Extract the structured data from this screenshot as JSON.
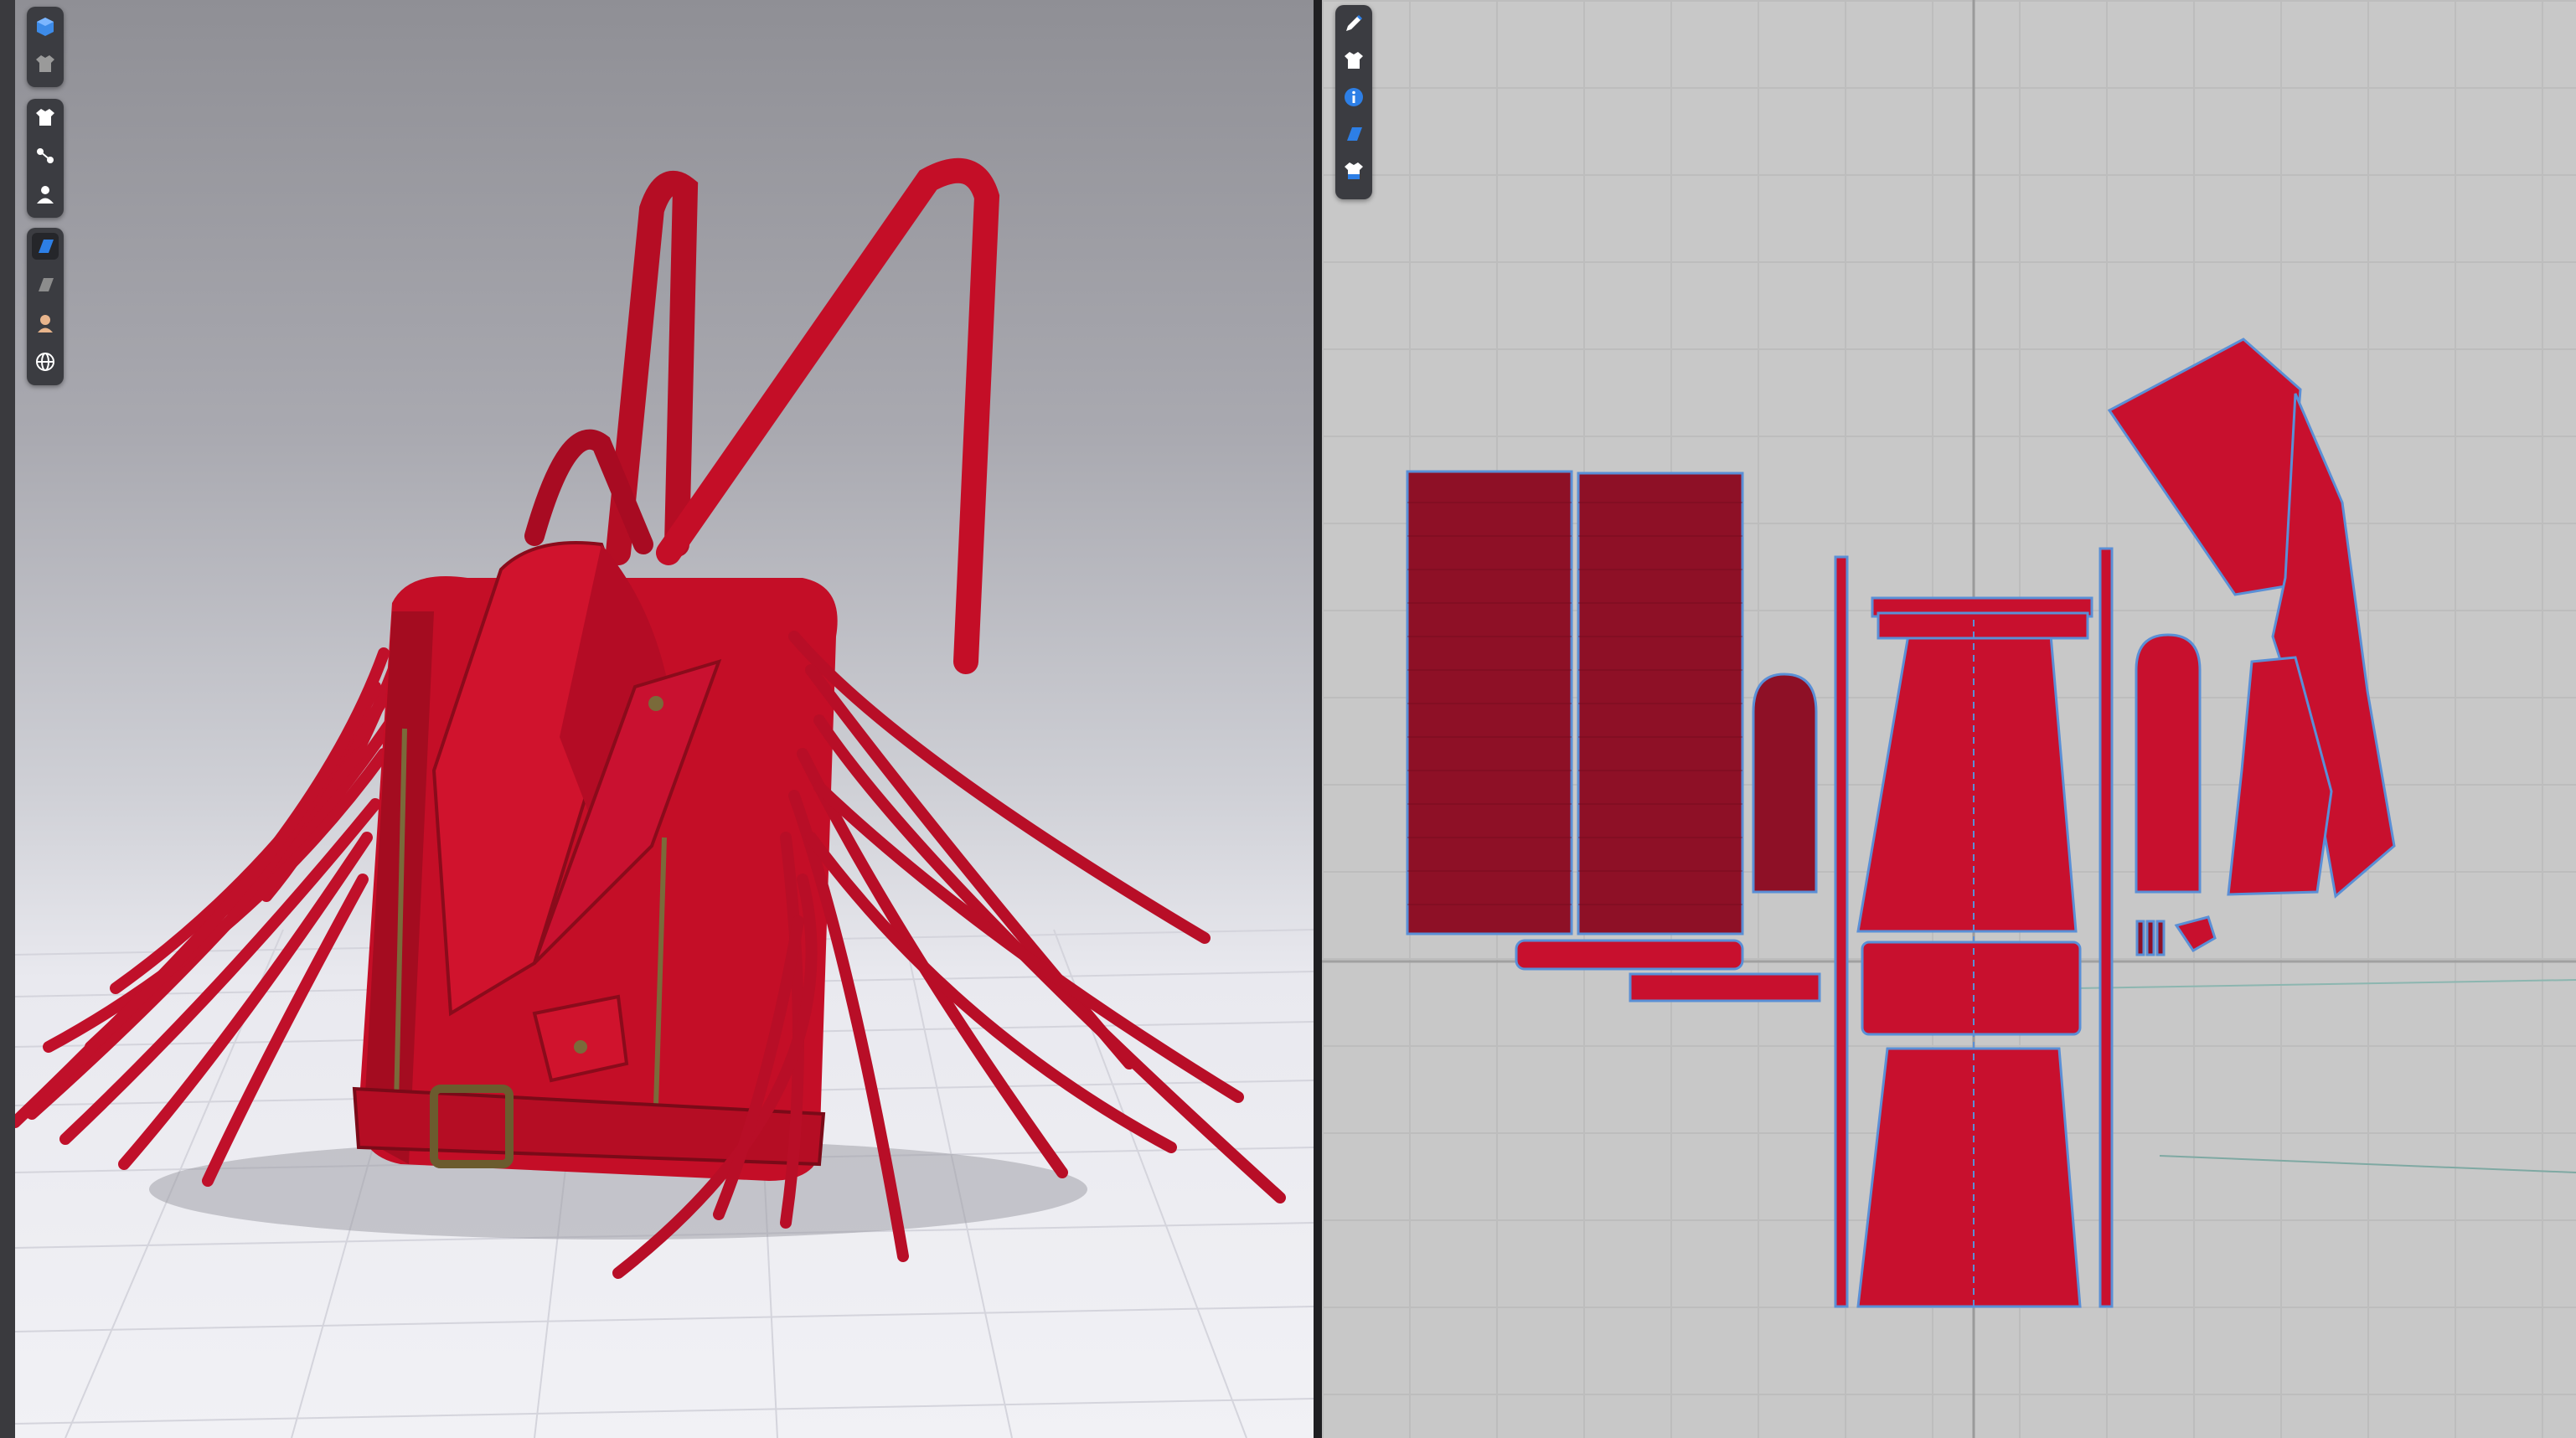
{
  "window": {
    "panels": [
      "3d-avatar-view",
      "2d-pattern-view"
    ]
  },
  "viewport3d": {
    "toolbar_groups": [
      [
        "cube-view-icon",
        "garment-shaded-icon"
      ],
      [
        "shirt-icon",
        "hanger-icon",
        "avatar-icon"
      ],
      [
        "texture-icon",
        "fabric-icon",
        "skin-icon",
        "globe-icon"
      ]
    ],
    "active_tool": "texture-icon"
  },
  "viewport2d": {
    "toolbar": [
      "pen-icon",
      "shirt-icon",
      "info-icon",
      "texture-icon",
      "garment-2d-icon"
    ]
  },
  "colors": {
    "leather": "#c40e27",
    "leather_dark": "#8a0b1b",
    "pattern_fill": "#c8102e",
    "pattern_dark": "#8e1026",
    "hardware": "#7a6a3a",
    "seam_line": "#5a8fd6"
  }
}
